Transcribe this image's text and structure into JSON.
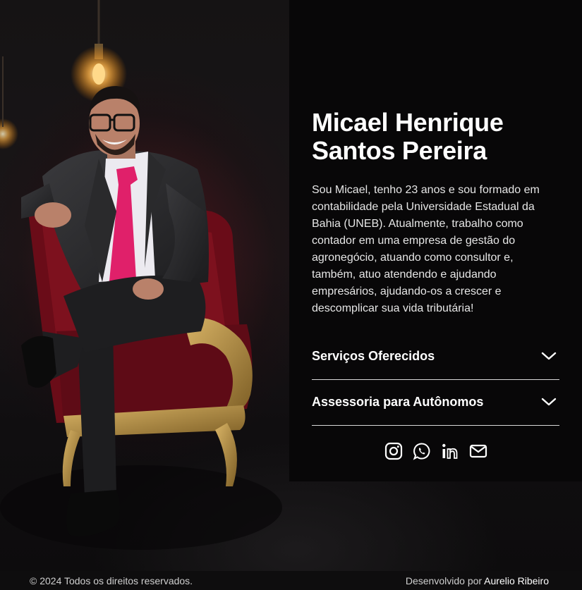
{
  "profile": {
    "name_line1": "Micael Henrique",
    "name_line2": "Santos Pereira",
    "bio": "Sou Micael, tenho 23 anos e sou formado em contabilidade pela Universidade Estadual da Bahia (UNEB). Atualmente, trabalho como contador em uma empresa de gestão do agronegócio, atuando como consultor e, também, atuo atendendo e ajudando empresários, ajudando-os a crescer e descomplicar sua vida tributária!"
  },
  "accordions": [
    {
      "label": "Serviços Oferecidos",
      "icon": "chevron-down-icon"
    },
    {
      "label": "Assessoria para Autônomos",
      "icon": "chevron-down-icon"
    }
  ],
  "social": [
    "instagram-icon",
    "whatsapp-icon",
    "linkedin-icon",
    "mail-icon"
  ],
  "footer": {
    "copyright": "© 2024 Todos os direitos reservados.",
    "developed_by": "Desenvolvido por",
    "developer": "Aurelio Ribeiro"
  },
  "colors": {
    "background": "#0b0a0b",
    "panel": "#080708",
    "tie": "#e0206a",
    "chair": "#7a0f1c",
    "chair_frame": "#b8934a"
  }
}
